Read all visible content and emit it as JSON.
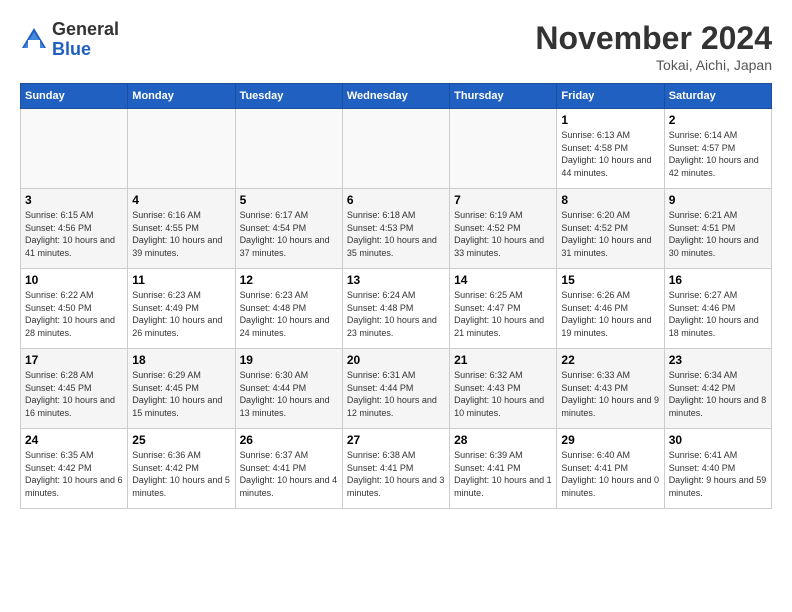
{
  "header": {
    "logo_general": "General",
    "logo_blue": "Blue",
    "month_title": "November 2024",
    "location": "Tokai, Aichi, Japan"
  },
  "weekdays": [
    "Sunday",
    "Monday",
    "Tuesday",
    "Wednesday",
    "Thursday",
    "Friday",
    "Saturday"
  ],
  "weeks": [
    [
      {
        "day": "",
        "info": ""
      },
      {
        "day": "",
        "info": ""
      },
      {
        "day": "",
        "info": ""
      },
      {
        "day": "",
        "info": ""
      },
      {
        "day": "",
        "info": ""
      },
      {
        "day": "1",
        "info": "Sunrise: 6:13 AM\nSunset: 4:58 PM\nDaylight: 10 hours and 44 minutes."
      },
      {
        "day": "2",
        "info": "Sunrise: 6:14 AM\nSunset: 4:57 PM\nDaylight: 10 hours and 42 minutes."
      }
    ],
    [
      {
        "day": "3",
        "info": "Sunrise: 6:15 AM\nSunset: 4:56 PM\nDaylight: 10 hours and 41 minutes."
      },
      {
        "day": "4",
        "info": "Sunrise: 6:16 AM\nSunset: 4:55 PM\nDaylight: 10 hours and 39 minutes."
      },
      {
        "day": "5",
        "info": "Sunrise: 6:17 AM\nSunset: 4:54 PM\nDaylight: 10 hours and 37 minutes."
      },
      {
        "day": "6",
        "info": "Sunrise: 6:18 AM\nSunset: 4:53 PM\nDaylight: 10 hours and 35 minutes."
      },
      {
        "day": "7",
        "info": "Sunrise: 6:19 AM\nSunset: 4:52 PM\nDaylight: 10 hours and 33 minutes."
      },
      {
        "day": "8",
        "info": "Sunrise: 6:20 AM\nSunset: 4:52 PM\nDaylight: 10 hours and 31 minutes."
      },
      {
        "day": "9",
        "info": "Sunrise: 6:21 AM\nSunset: 4:51 PM\nDaylight: 10 hours and 30 minutes."
      }
    ],
    [
      {
        "day": "10",
        "info": "Sunrise: 6:22 AM\nSunset: 4:50 PM\nDaylight: 10 hours and 28 minutes."
      },
      {
        "day": "11",
        "info": "Sunrise: 6:23 AM\nSunset: 4:49 PM\nDaylight: 10 hours and 26 minutes."
      },
      {
        "day": "12",
        "info": "Sunrise: 6:23 AM\nSunset: 4:48 PM\nDaylight: 10 hours and 24 minutes."
      },
      {
        "day": "13",
        "info": "Sunrise: 6:24 AM\nSunset: 4:48 PM\nDaylight: 10 hours and 23 minutes."
      },
      {
        "day": "14",
        "info": "Sunrise: 6:25 AM\nSunset: 4:47 PM\nDaylight: 10 hours and 21 minutes."
      },
      {
        "day": "15",
        "info": "Sunrise: 6:26 AM\nSunset: 4:46 PM\nDaylight: 10 hours and 19 minutes."
      },
      {
        "day": "16",
        "info": "Sunrise: 6:27 AM\nSunset: 4:46 PM\nDaylight: 10 hours and 18 minutes."
      }
    ],
    [
      {
        "day": "17",
        "info": "Sunrise: 6:28 AM\nSunset: 4:45 PM\nDaylight: 10 hours and 16 minutes."
      },
      {
        "day": "18",
        "info": "Sunrise: 6:29 AM\nSunset: 4:45 PM\nDaylight: 10 hours and 15 minutes."
      },
      {
        "day": "19",
        "info": "Sunrise: 6:30 AM\nSunset: 4:44 PM\nDaylight: 10 hours and 13 minutes."
      },
      {
        "day": "20",
        "info": "Sunrise: 6:31 AM\nSunset: 4:44 PM\nDaylight: 10 hours and 12 minutes."
      },
      {
        "day": "21",
        "info": "Sunrise: 6:32 AM\nSunset: 4:43 PM\nDaylight: 10 hours and 10 minutes."
      },
      {
        "day": "22",
        "info": "Sunrise: 6:33 AM\nSunset: 4:43 PM\nDaylight: 10 hours and 9 minutes."
      },
      {
        "day": "23",
        "info": "Sunrise: 6:34 AM\nSunset: 4:42 PM\nDaylight: 10 hours and 8 minutes."
      }
    ],
    [
      {
        "day": "24",
        "info": "Sunrise: 6:35 AM\nSunset: 4:42 PM\nDaylight: 10 hours and 6 minutes."
      },
      {
        "day": "25",
        "info": "Sunrise: 6:36 AM\nSunset: 4:42 PM\nDaylight: 10 hours and 5 minutes."
      },
      {
        "day": "26",
        "info": "Sunrise: 6:37 AM\nSunset: 4:41 PM\nDaylight: 10 hours and 4 minutes."
      },
      {
        "day": "27",
        "info": "Sunrise: 6:38 AM\nSunset: 4:41 PM\nDaylight: 10 hours and 3 minutes."
      },
      {
        "day": "28",
        "info": "Sunrise: 6:39 AM\nSunset: 4:41 PM\nDaylight: 10 hours and 1 minute."
      },
      {
        "day": "29",
        "info": "Sunrise: 6:40 AM\nSunset: 4:41 PM\nDaylight: 10 hours and 0 minutes."
      },
      {
        "day": "30",
        "info": "Sunrise: 6:41 AM\nSunset: 4:40 PM\nDaylight: 9 hours and 59 minutes."
      }
    ]
  ]
}
